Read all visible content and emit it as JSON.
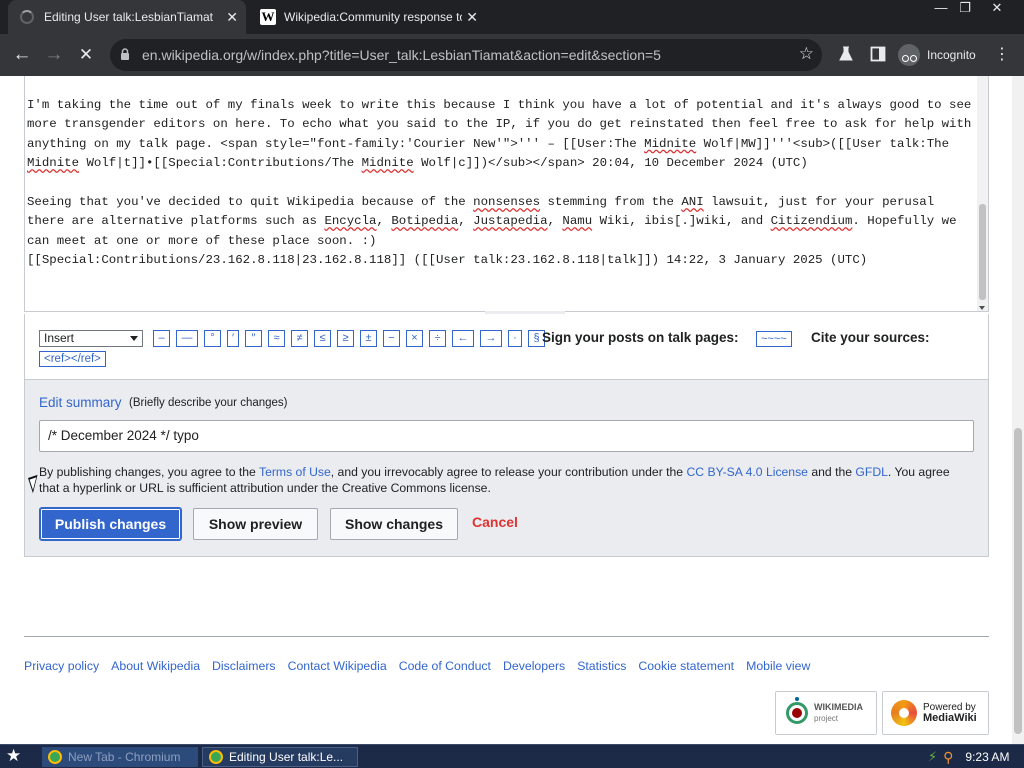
{
  "browser": {
    "tabs": [
      {
        "title": "Editing User talk:LesbianTiamat (sec",
        "active": true
      },
      {
        "title": "Wikipedia:Community response to A",
        "active": false
      }
    ],
    "url": "en.wikipedia.org/w/index.php?title=User_talk:LesbianTiamat&action=edit&section=5",
    "profile_label": "Incognito",
    "window_controls": [
      "—",
      "❐",
      "✕"
    ]
  },
  "editor": {
    "lines": [
      "I'm taking the time out of my finals week to write this because I think you have a lot of potential and it's always good to see more transgender editors on here. To echo what you said to the IP, if you do get reinstated then feel free to ask for help with anything on my talk page. <span style=\"font-family:'Courier New'\">''' – [[User:The ",
      "Midnite",
      " Wolf|MW]]'''<sub>([[User talk:The ",
      "Midnite",
      " Wolf|t]]•[[Special:Contributions/The ",
      "Midnite",
      " Wolf|c]])</sub></span> 20:04, 10 December 2024 (UTC)\n\nSeeing that you've decided to quit Wikipedia because of the ",
      "nonsenses",
      " stemming from the ",
      "ANI",
      " lawsuit, just for your perusal there are alternative platforms such as ",
      "Encycla",
      ", ",
      "Botipedia",
      ", ",
      "Justapedia",
      ", ",
      "Namu",
      " Wiki, ibis[.]wiki, and ",
      "Citizendium",
      ". Hopefully we can meet at one or more of these place soon. :)\n[[Special:Contributions/23.162.8.118|23.162.8.118]] ([[User talk:23.162.8.118|talk]]) 14:22, 3 January 2025 (UTC)"
    ]
  },
  "charinsert": {
    "select_value": "Insert",
    "chars": [
      "–",
      "—",
      "°",
      "′",
      "″",
      "≈",
      "≠",
      "≤",
      "≥",
      "±",
      "−",
      "×",
      "÷",
      "←",
      "→",
      "·",
      "§"
    ],
    "sign_label": "Sign your posts on talk pages:",
    "sign_button": "~~~~",
    "cite_label": "Cite your sources:",
    "ref_button": "<ref></ref>"
  },
  "edit_summary": {
    "label": "Edit summary",
    "hint": "(Briefly describe your changes)",
    "value": "/* December 2024 */ typo"
  },
  "legal": {
    "part1": "By publishing changes, you agree to the ",
    "terms": "Terms of Use",
    "part2": ", and you irrevocably agree to release your contribution under the ",
    "license": "CC BY-SA 4.0 License",
    "part3": " and the ",
    "gfdl": "GFDL",
    "part4": ". You agree that a hyperlink or URL is sufficient attribution under the Creative Commons license."
  },
  "buttons": {
    "publish": "Publish changes",
    "preview": "Show preview",
    "changes": "Show changes",
    "cancel": "Cancel"
  },
  "footer": {
    "links": [
      "Privacy policy",
      "About Wikipedia",
      "Disclaimers",
      "Contact Wikipedia",
      "Code of Conduct",
      "Developers",
      "Statistics",
      "Cookie statement",
      "Mobile view"
    ],
    "wikimedia_badge": [
      "WIKIMEDIA",
      "project"
    ],
    "mediawiki_badge": [
      "Powered by",
      "MediaWiki"
    ]
  },
  "taskbar": {
    "tasks": [
      "New Tab - Chromium",
      "Editing User talk:Le..."
    ],
    "clock": "9:23 AM"
  }
}
